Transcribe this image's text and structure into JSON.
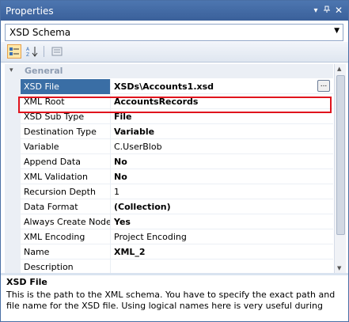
{
  "window": {
    "title": "Properties"
  },
  "object_selector": {
    "value": "XSD Schema"
  },
  "toolbar": {
    "categorized": "categorized-view",
    "alphabetical": "alphabetical-view",
    "property_pages": "property-pages"
  },
  "grid": {
    "category": "General",
    "rows": [
      {
        "name": "XSD File",
        "value": "XSDs\\Accounts1.xsd",
        "bold": true,
        "selected": true,
        "has_ellipsis": true
      },
      {
        "name": "XML Root",
        "value": "AccountsRecords",
        "bold": true
      },
      {
        "name": "XSD Sub Type",
        "value": "File",
        "bold": true
      },
      {
        "name": "Destination Type",
        "value": "Variable",
        "bold": true
      },
      {
        "name": "Variable",
        "value": "C.UserBlob",
        "bold": false
      },
      {
        "name": "Append Data",
        "value": "No",
        "bold": true
      },
      {
        "name": "XML Validation",
        "value": "No",
        "bold": true
      },
      {
        "name": "Recursion Depth",
        "value": "1",
        "bold": false
      },
      {
        "name": "Data Format",
        "value": "(Collection)",
        "bold": true
      },
      {
        "name": "Always Create Nodes",
        "value": "Yes",
        "bold": true
      },
      {
        "name": "XML Encoding",
        "value": "Project Encoding",
        "bold": false
      },
      {
        "name": "Name",
        "value": "XML_2",
        "bold": true
      },
      {
        "name": "Description",
        "value": "",
        "bold": false
      }
    ]
  },
  "description": {
    "title": "XSD File",
    "text": "This is the path to the XML schema. You have to specify the exact path and file name for the XSD file. Using logical names here is very useful during deploym..."
  },
  "colors": {
    "titlebar": "#4d76b0",
    "highlight": "#e0141d",
    "category_text": "#8e9cb1",
    "selected_row": "#3a6ea5"
  }
}
